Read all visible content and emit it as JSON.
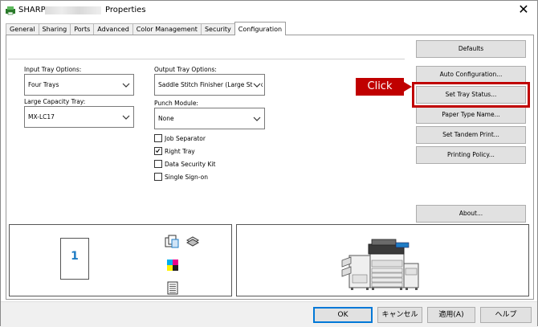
{
  "window": {
    "title_prefix": "SHARP",
    "title_suffix": "Properties",
    "close_glyph": "✕"
  },
  "tabs": [
    {
      "label": "General"
    },
    {
      "label": "Sharing"
    },
    {
      "label": "Ports"
    },
    {
      "label": "Advanced"
    },
    {
      "label": "Color Management"
    },
    {
      "label": "Security"
    },
    {
      "label": "Configuration",
      "active": true
    }
  ],
  "config": {
    "input_tray_label": "Input Tray Options:",
    "input_tray_value": "Four Trays",
    "large_capacity_label": "Large Capacity Tray:",
    "large_capacity_value": "MX-LC17",
    "output_tray_label": "Output Tray Options:",
    "output_tray_value": "Saddle Stitch Finisher (Large Stack",
    "punch_module_label": "Punch Module:",
    "punch_module_value": "None",
    "checkboxes": [
      {
        "label": "Job Separator",
        "checked": false
      },
      {
        "label": "Right Tray",
        "checked": true
      },
      {
        "label": "Data Security Kit",
        "checked": false
      },
      {
        "label": "Single Sign-on",
        "checked": false
      }
    ]
  },
  "buttons": {
    "defaults": "Defaults",
    "auto_configuration": "Auto Configuration...",
    "set_tray_status": "Set Tray Status...",
    "paper_type_name": "Paper Type Name...",
    "set_tandem_print": "Set Tandem Print...",
    "printing_policy": "Printing Policy...",
    "about": "About..."
  },
  "callout": {
    "text": "Click",
    "color": "#c00000"
  },
  "preview": {
    "page_number": "1"
  },
  "dialog_buttons": {
    "ok": "OK",
    "cancel": "キャンセル",
    "apply": "適用(A)",
    "help": "ヘルプ"
  },
  "colors": {
    "accent": "#0078d7",
    "highlight": "#c00000",
    "page_number": "#1f7cc4"
  }
}
